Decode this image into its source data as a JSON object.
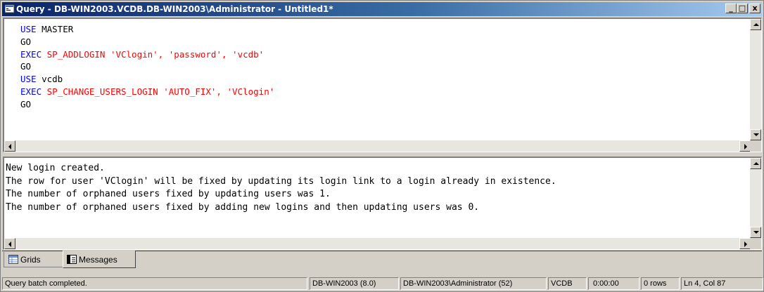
{
  "window": {
    "title": "Query - DB-WIN2003.VCDB.DB-WIN2003\\Administrator - Untitled1*",
    "controls": {
      "minimize": "_",
      "maximize": "□",
      "close": "x"
    }
  },
  "editor": {
    "lines": [
      [
        {
          "t": "USE",
          "c": "kw"
        },
        {
          "t": " MASTER",
          "c": "plain"
        }
      ],
      [
        {
          "t": "GO",
          "c": "plain"
        }
      ],
      [
        {
          "t": "EXEC",
          "c": "kw"
        },
        {
          "t": " ",
          "c": "plain"
        },
        {
          "t": "SP_ADDLOGIN 'VClogin', 'password', 'vcdb'",
          "c": "str"
        }
      ],
      [
        {
          "t": "GO",
          "c": "plain"
        }
      ],
      [
        {
          "t": "USE",
          "c": "kw"
        },
        {
          "t": " vcdb",
          "c": "plain"
        }
      ],
      [
        {
          "t": "EXEC",
          "c": "kw"
        },
        {
          "t": " ",
          "c": "plain"
        },
        {
          "t": "SP_CHANGE_USERS_LOGIN 'AUTO_FIX', 'VClogin'",
          "c": "str"
        }
      ],
      [
        {
          "t": "GO",
          "c": "plain"
        }
      ]
    ]
  },
  "messages": [
    "New login created.",
    "The row for user 'VClogin' will be fixed by updating its login link to a login already in existence.",
    "The number of orphaned users fixed by updating users was 1.",
    "The number of orphaned users fixed by adding new logins and then updating users was 0."
  ],
  "tabs": [
    {
      "label": "Grids",
      "icon": "grid-icon",
      "active": false
    },
    {
      "label": "Messages",
      "icon": "messages-icon",
      "active": true
    }
  ],
  "status": {
    "message": "Query batch completed.",
    "server": "DB-WIN2003 (8.0)",
    "user": "DB-WIN2003\\Administrator (52)",
    "database": "VCDB",
    "elapsed": "0:00:00",
    "rows": "0 rows",
    "position": "Ln 4, Col 87"
  },
  "colors": {
    "keyword": "#0000ff",
    "string": "#ff0000",
    "titlebar_start": "#0a246a",
    "titlebar_end": "#a6caf0"
  }
}
